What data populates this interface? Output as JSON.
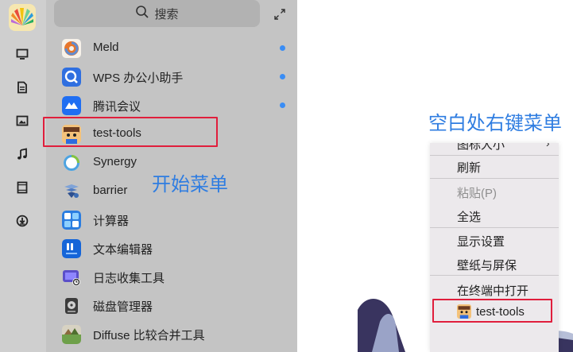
{
  "launcher": {
    "search_placeholder": "搜索",
    "apps": [
      {
        "label": "Meld",
        "icon": "meld-icon",
        "new": true
      },
      {
        "label": "WPS 办公小助手",
        "icon": "wps-assistant-icon",
        "new": true
      },
      {
        "label": "腾讯会议",
        "icon": "tencent-meeting-icon",
        "new": true
      },
      {
        "label": "test-tools",
        "icon": "test-tools-icon",
        "new": false
      },
      {
        "label": "Synergy",
        "icon": "synergy-icon",
        "new": false
      },
      {
        "label": "barrier",
        "icon": "barrier-icon",
        "new": false
      },
      {
        "label": "计算器",
        "icon": "calculator-icon",
        "new": false
      },
      {
        "label": "文本编辑器",
        "icon": "text-editor-icon",
        "new": false
      },
      {
        "label": "日志收集工具",
        "icon": "log-collector-icon",
        "new": false
      },
      {
        "label": "磁盘管理器",
        "icon": "disk-manager-icon",
        "new": false
      },
      {
        "label": "Diffuse 比较合并工具",
        "icon": "diffuse-icon",
        "new": false
      }
    ],
    "annotation": "开始菜单"
  },
  "desktop": {
    "annotation": "空白处右键菜单",
    "context_menu": {
      "items": [
        {
          "label": "图标大小",
          "cut": true
        },
        {
          "label": "刷新"
        },
        {
          "label": "粘贴(P)",
          "disabled": true
        },
        {
          "label": "全选"
        },
        {
          "label": "显示设置"
        },
        {
          "label": "壁纸与屏保"
        },
        {
          "label": "在终端中打开"
        },
        {
          "label": "test-tools",
          "icon": "test-tools-icon"
        }
      ]
    }
  },
  "colors": {
    "accent": "#2f7de1",
    "highlight_box": "#e01e3c",
    "new_dot": "#3a8df5"
  }
}
